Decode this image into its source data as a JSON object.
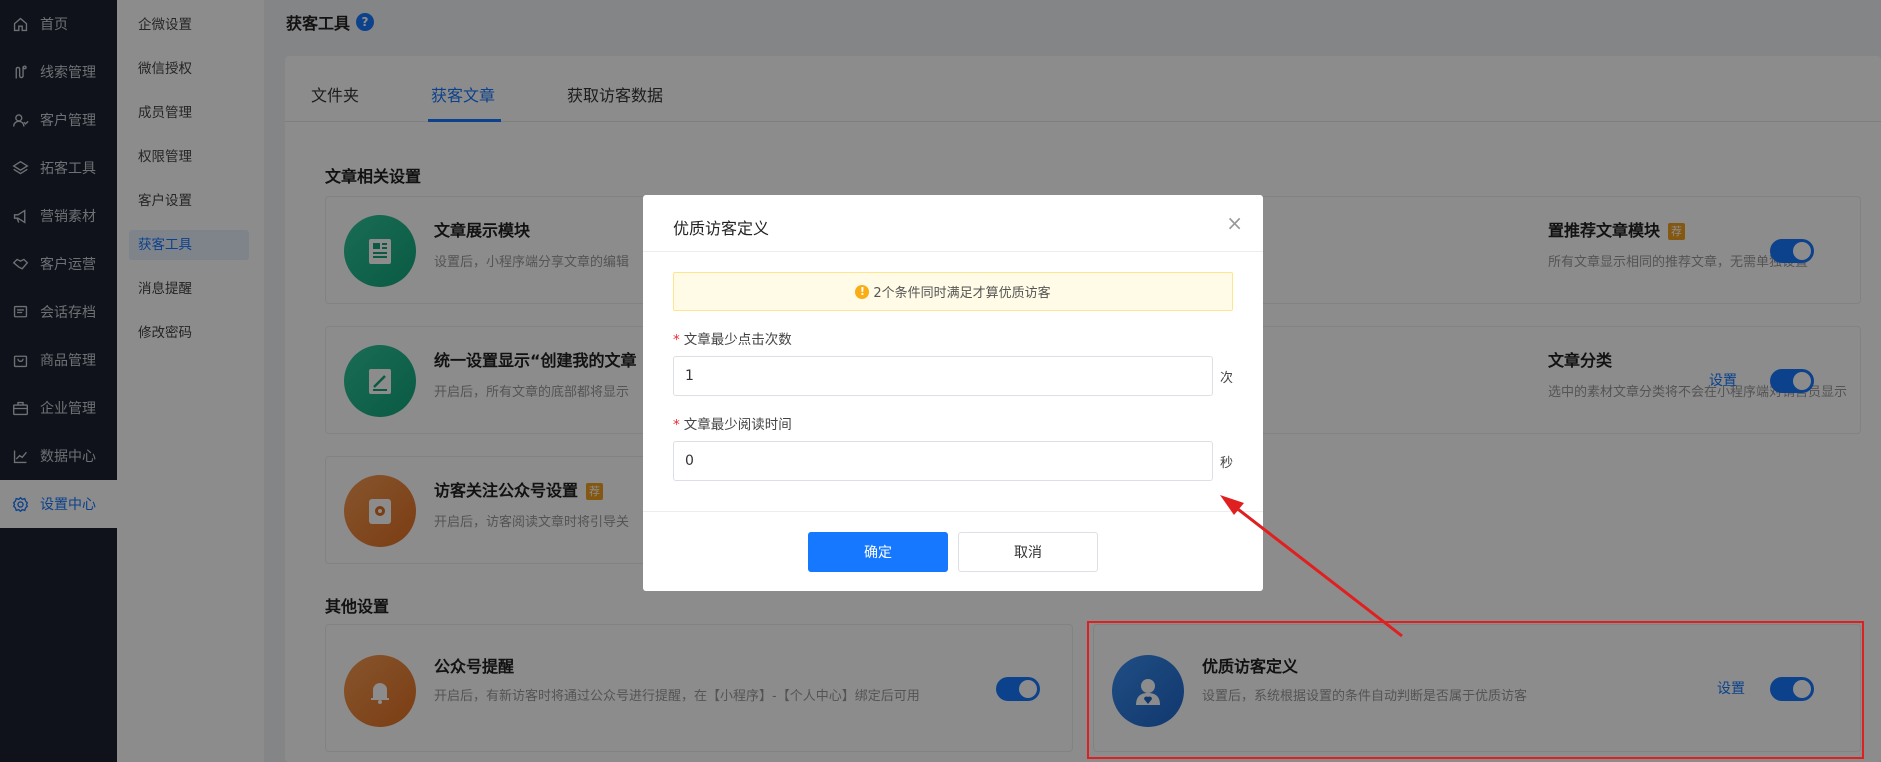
{
  "nav": {
    "items": [
      {
        "label": "首页",
        "icon": "home-icon"
      },
      {
        "label": "线索管理",
        "icon": "route-icon"
      },
      {
        "label": "客户管理",
        "icon": "users-icon"
      },
      {
        "label": "拓客工具",
        "icon": "box-icon"
      },
      {
        "label": "营销素材",
        "icon": "megaphone-icon"
      },
      {
        "label": "客户运营",
        "icon": "handshake-icon"
      },
      {
        "label": "会话存档",
        "icon": "chat-icon"
      },
      {
        "label": "商品管理",
        "icon": "bag-icon"
      },
      {
        "label": "企业管理",
        "icon": "briefcase-icon"
      },
      {
        "label": "数据中心",
        "icon": "chart-icon"
      },
      {
        "label": "设置中心",
        "icon": "gear-icon"
      }
    ],
    "active_index": 10
  },
  "submenu": {
    "items": [
      "企微设置",
      "微信授权",
      "成员管理",
      "权限管理",
      "客户设置",
      "获客工具",
      "消息提醒",
      "修改密码"
    ],
    "active_index": 5
  },
  "page": {
    "title": "获客工具",
    "help": "?"
  },
  "tabs": [
    "文件夹",
    "获客文章",
    "获取访客数据"
  ],
  "sections": {
    "article": "文章相关设置",
    "other": "其他设置"
  },
  "cards": {
    "display_module": {
      "title": "文章展示模块",
      "desc": "设置后，小程序端分享文章的编辑"
    },
    "recommend": {
      "title": "置推荐文章模块",
      "badge": "荐",
      "desc": "所有文章显示相同的推荐文章，无需单独设置"
    },
    "unified": {
      "title": "统一设置显示“创建我的文章",
      "desc": "开启后，所有文章的底部都将显示"
    },
    "category": {
      "title": "文章分类",
      "desc": "选中的素材文章分类将不会在小程序端对销售员显示",
      "link": "设置"
    },
    "follow": {
      "title": "访客关注公众号设置",
      "badge": "荐",
      "desc": "开启后，访客阅读文章时将引导关"
    },
    "reminder": {
      "title": "公众号提醒",
      "desc": "开启后，有新访客时将通过公众号进行提醒，在【小程序】-【个人中心】绑定后可用"
    },
    "quality": {
      "title": "优质访客定义",
      "desc": "设置后，系统根据设置的条件自动判断是否属于优质访客",
      "link": "设置"
    }
  },
  "modal": {
    "title": "优质访客定义",
    "close": "×",
    "alert": "2个条件同时满足才算优质访客",
    "fields": [
      {
        "label": "文章最少点击次数",
        "value": "1",
        "unit": "次"
      },
      {
        "label": "文章最少阅读时间",
        "value": "0",
        "unit": "秒"
      }
    ],
    "confirm": "确定",
    "cancel": "取消"
  },
  "colors": {
    "accent": "#1677ff",
    "annotation": "#e02020",
    "nav_bg": "#1c2230"
  }
}
